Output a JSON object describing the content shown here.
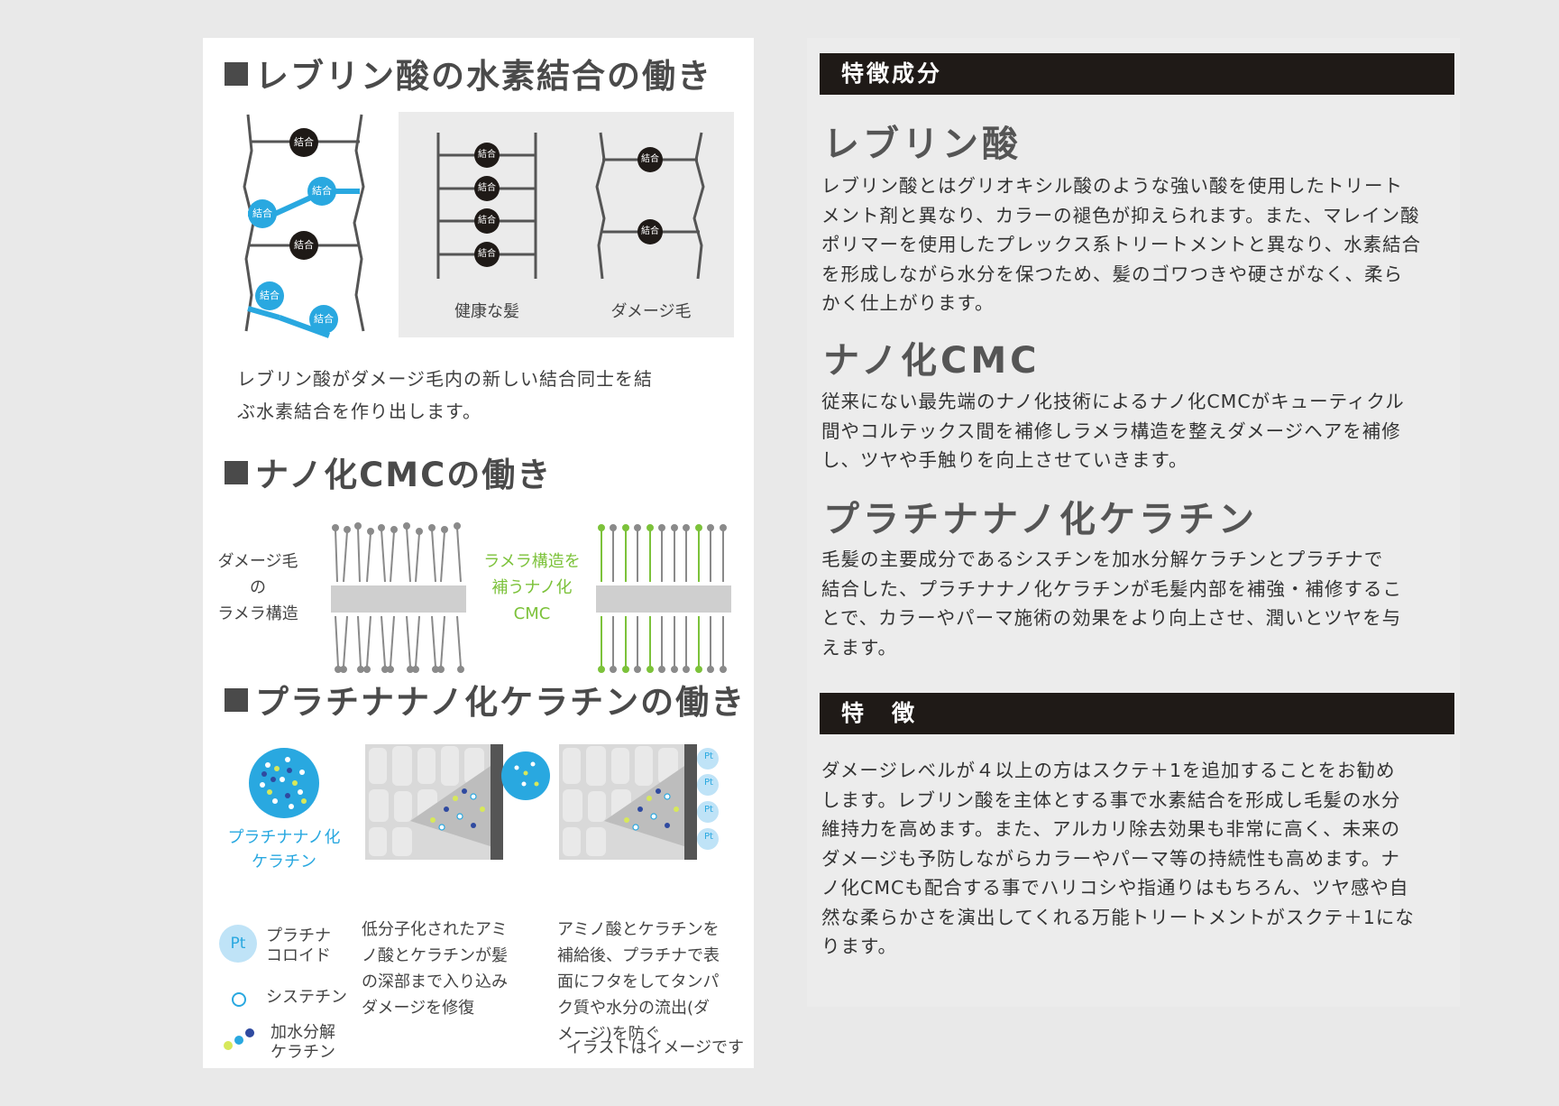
{
  "left": {
    "section1": {
      "title": "レブリン酸の水素結合の働き",
      "bond_label": "結合",
      "healthy_label": "健康な髪",
      "damaged_label": "ダメージ毛",
      "caption_line1": "レブリン酸がダメージ毛内の新しい結合同士を結",
      "caption_line2": "ぶ水素結合を作り出します。"
    },
    "section2": {
      "title": "ナノ化CMCの働き",
      "left_label": [
        "ダメージ毛",
        "の",
        "ラメラ構造"
      ],
      "right_label": [
        "ラメラ構造を",
        "補うナノ化",
        "CMC"
      ]
    },
    "section3": {
      "title": "プラチナナノ化ケラチンの働き",
      "keratin_label": [
        "プラチナナノ化",
        "ケラチン"
      ],
      "legend": {
        "pt_symbol": "Pt",
        "platinum": [
          "プラチナ",
          "コロイド"
        ],
        "cystine": "システチン",
        "hydrolyzed": [
          "加水分解",
          "ケラチン"
        ]
      },
      "step1": [
        "低分子化されたアミ",
        "ノ酸とケラチンが髪",
        "の深部まで入り込み",
        "ダメージを修復"
      ],
      "step2": [
        "アミノ酸とケラチンを",
        "補給後、プラチナで表",
        "面にフタをしてタンパ",
        "ク質や水分の流出(ダ",
        "メージ)を防ぐ"
      ],
      "note": "イラストはイメージです"
    }
  },
  "right": {
    "features_bar": "特徴成分",
    "ingredients": [
      {
        "name": "レブリン酸",
        "lines": [
          "レブリン酸とはグリオキシル酸のような強い酸を使用したトリート",
          "メント剤と異なり、カラーの褪色が抑えられます。また、マレイン酸",
          "ポリマーを使用したプレックス系トリートメントと異なり、水素結合",
          "を形成しながら水分を保つため、髪のゴワつきや硬さがなく、柔ら",
          "かく仕上がります。"
        ]
      },
      {
        "name": "ナノ化CMC",
        "lines": [
          "従来にない最先端のナノ化技術によるナノ化CMCがキューティクル",
          "間やコルテックス間を補修しラメラ構造を整えダメージヘアを補修",
          "し、ツヤや手触りを向上させていきます。"
        ]
      },
      {
        "name": "プラチナナノ化ケラチン",
        "lines": [
          "毛髪の主要成分であるシスチンを加水分解ケラチンとプラチナで",
          "結合した、プラチナナノ化ケラチンが毛髪内部を補強・補修するこ",
          "とで、カラーやパーマ施術の効果をより向上させ、潤いとツヤを与",
          "えます。"
        ]
      }
    ],
    "traits_bar": "特　徴",
    "traits_lines": [
      "ダメージレベルが４以上の方はスクテ＋1を追加することをお勧め",
      "します。レブリン酸を主体とする事で水素結合を形成し毛髪の水分",
      "維持力を高めます。また、アルカリ除去効果も非常に高く、未来の",
      "ダメージも予防しながらカラーやパーマ等の持続性も高めます。ナ",
      "ノ化CMCも配合する事でハリコシや指通りはもちろん、ツヤ感や自",
      "然な柔らかさを演出してくれる万能トリートメントがスクテ＋1にな",
      "ります。"
    ]
  },
  "colors": {
    "blue": "#29a8e0",
    "dark": "#1f1a17",
    "green": "#7cc23a",
    "pale_blue": "#bfe3f7"
  }
}
